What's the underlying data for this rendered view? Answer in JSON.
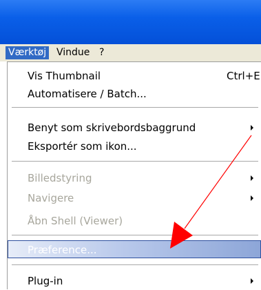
{
  "menubar": {
    "items": [
      {
        "label": "Værktøj"
      },
      {
        "label": "Vindue"
      },
      {
        "label": "?"
      }
    ]
  },
  "menu": {
    "items": [
      {
        "label": "Vis Thumbnail",
        "shortcut": "Ctrl+E",
        "enabled": true
      },
      {
        "label": "Automatisere / Batch...",
        "enabled": true
      },
      {
        "label": "Benyt som skrivebordsbaggrund",
        "enabled": true,
        "submenu": true
      },
      {
        "label": "Eksportér som ikon...",
        "enabled": true
      },
      {
        "label": "Billedstyring",
        "enabled": false,
        "submenu": true
      },
      {
        "label": "Navigere",
        "enabled": false,
        "submenu": true
      },
      {
        "label": "Åbn Shell (Viewer)",
        "enabled": false
      },
      {
        "label": "Præference...",
        "enabled": true,
        "highlighted": true
      },
      {
        "label": "Plug-in",
        "enabled": true,
        "submenu": true
      }
    ]
  },
  "annotation": {
    "arrow_color": "#ff0000"
  },
  "colors": {
    "titlebar": "#0a5fe8",
    "menubar": "#ece9d8",
    "active_menu": "#316ac5",
    "disabled_text": "#a7a69c"
  }
}
